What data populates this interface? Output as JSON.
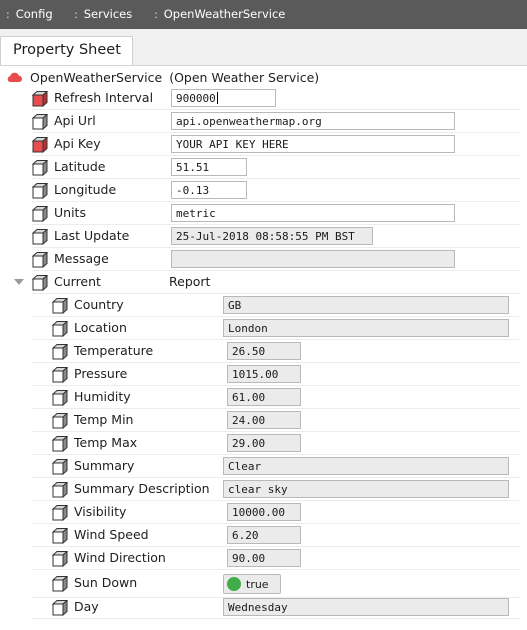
{
  "breadcrumb": [
    {
      "label": "Config"
    },
    {
      "label": "Services"
    },
    {
      "label": "OpenWeatherService"
    }
  ],
  "tab": {
    "label": "Property Sheet"
  },
  "root": {
    "name": "OpenWeatherService",
    "type": "(Open Weather Service)"
  },
  "properties": [
    {
      "label": "Refresh Interval",
      "value": "900000",
      "icon": "slot-red-icon"
    },
    {
      "label": "Api Url",
      "value": "api.openweathermap.org",
      "icon": "slot-icon"
    },
    {
      "label": "Api Key",
      "value": "YOUR API KEY HERE",
      "icon": "slot-red-icon"
    },
    {
      "label": "Latitude",
      "value": "51.51",
      "icon": "slot-icon"
    },
    {
      "label": "Longitude",
      "value": "-0.13",
      "icon": "slot-icon"
    },
    {
      "label": "Units",
      "value": "metric",
      "icon": "slot-icon"
    },
    {
      "label": "Last Update",
      "value": "25-Jul-2018 08:58:55 PM BST",
      "icon": "slot-icon"
    },
    {
      "label": "Message",
      "value": "",
      "icon": "slot-icon"
    }
  ],
  "current": {
    "label": "Current",
    "value": "Report"
  },
  "report": [
    {
      "label": "Country",
      "value": "GB"
    },
    {
      "label": "Location",
      "value": "London"
    },
    {
      "label": "Temperature",
      "value": "26.50"
    },
    {
      "label": "Pressure",
      "value": "1015.00"
    },
    {
      "label": "Humidity",
      "value": "61.00"
    },
    {
      "label": "Temp Min",
      "value": "24.00"
    },
    {
      "label": "Temp Max",
      "value": "29.00"
    },
    {
      "label": "Summary",
      "value": "Clear"
    },
    {
      "label": "Summary Description",
      "value": "clear sky"
    },
    {
      "label": "Visibility",
      "value": "10000.00"
    },
    {
      "label": "Wind Speed",
      "value": "6.20"
    },
    {
      "label": "Wind Direction",
      "value": "90.00"
    },
    {
      "label": "Sun Down",
      "value": "true",
      "status_color": "#3fae49"
    },
    {
      "label": "Day",
      "value": "Wednesday"
    }
  ],
  "colors": {
    "alarm_icon": "#e84c4c",
    "topbar": "#5a5a5a"
  }
}
